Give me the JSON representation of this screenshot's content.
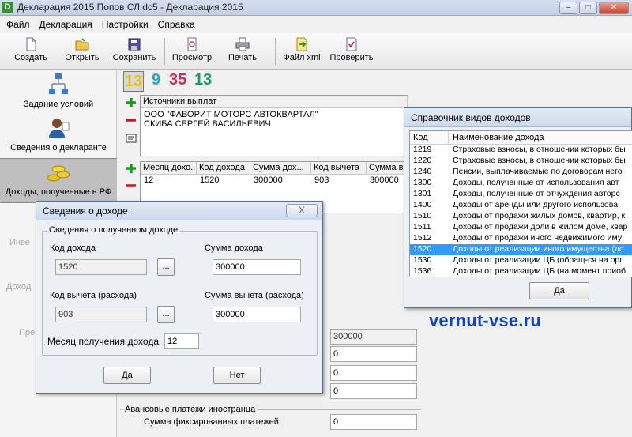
{
  "window": {
    "title": "Декларация 2015 Попов СЛ.dc5 - Декларация 2015",
    "app_icon_letter": "D"
  },
  "menu": [
    "Файл",
    "Декларация",
    "Настройки",
    "Справка"
  ],
  "toolbar": {
    "create": "Создать",
    "open": "Открыть",
    "save": "Сохранить",
    "preview": "Просмотр",
    "print": "Печать",
    "xml": "Файл xml",
    "check": "Проверить"
  },
  "left_panel": {
    "conditions": "Задание условий",
    "declarant": "Сведения о декларанте",
    "income_rf": "Доходы, полученные в РФ",
    "ghost_1": "Инве",
    "ghost_2": "Доход",
    "ghost_3": "Пре"
  },
  "rate_tabs": [
    "13",
    "9",
    "35",
    "13"
  ],
  "sources": {
    "header": "Источники выплат",
    "rows": [
      "ООО \"ФАВОРИТ МОТОРС АВТОКВАРТАЛ\"",
      "СКИБА СЕРГЕЙ ВАСИЛЬЕВИЧ"
    ]
  },
  "income_table": {
    "headers": [
      "Месяц дохо...",
      "Код дохода",
      "Сумма дох...",
      "Код вычета",
      "Сумма в"
    ],
    "rows": [
      [
        "12",
        "1520",
        "300000",
        "903",
        "300000"
      ]
    ]
  },
  "summary_fields": {
    "total": "300000",
    "f2": "0",
    "f3": "0",
    "f4": "0",
    "advance_group": "Авансовые платежи иностранца",
    "fixed_label": "Сумма фиксированных платежей",
    "fixed_value": "0"
  },
  "dialog_income": {
    "title": "Сведения о доходе",
    "group_title": "Сведения о полученном доходе",
    "income_code_label": "Код дохода",
    "income_code_value": "1520",
    "income_sum_label": "Сумма дохода",
    "income_sum_value": "300000",
    "deduction_code_label": "Код вычета (расхода)",
    "deduction_code_value": "903",
    "deduction_sum_label": "Сумма вычета (расхода)",
    "deduction_sum_value": "300000",
    "month_label": "Месяц получения дохода",
    "month_value": "12",
    "browse": "...",
    "yes": "Да",
    "no": "Нет",
    "close": "X"
  },
  "dialog_ref": {
    "title": "Справочник видов доходов",
    "col_code": "Код",
    "col_name": "Наименование дохода",
    "rows": [
      {
        "code": "1219",
        "name": "Страховые взносы, в отношении которых бы"
      },
      {
        "code": "1220",
        "name": "Страховые взносы, в отношении которых бы"
      },
      {
        "code": "1240",
        "name": "Пенсии, выплачиваемые по договорам него"
      },
      {
        "code": "1300",
        "name": "Доходы, полученные от использования авт"
      },
      {
        "code": "1301",
        "name": "Доходы, полученные от отчуждения авторс"
      },
      {
        "code": "1400",
        "name": "Доходы от аренды или другого использова"
      },
      {
        "code": "1510",
        "name": "Доходы от продажи жилых домов, квартир, к"
      },
      {
        "code": "1511",
        "name": "Доходы от продажи доли в жилом доме, квар"
      },
      {
        "code": "1512",
        "name": "Доходы от продажи иного недвижимого иму"
      },
      {
        "code": "1520",
        "name": "Доходы от реализации иного имущества (дс"
      },
      {
        "code": "1530",
        "name": "Доходы от реализации ЦБ (обращ-ся на орг."
      },
      {
        "code": "1536",
        "name": "Доходы от реализации ЦБ (на момент приоб"
      }
    ],
    "selected_code": "1520",
    "yes": "Да"
  },
  "watermark": "vernut-vse.ru"
}
